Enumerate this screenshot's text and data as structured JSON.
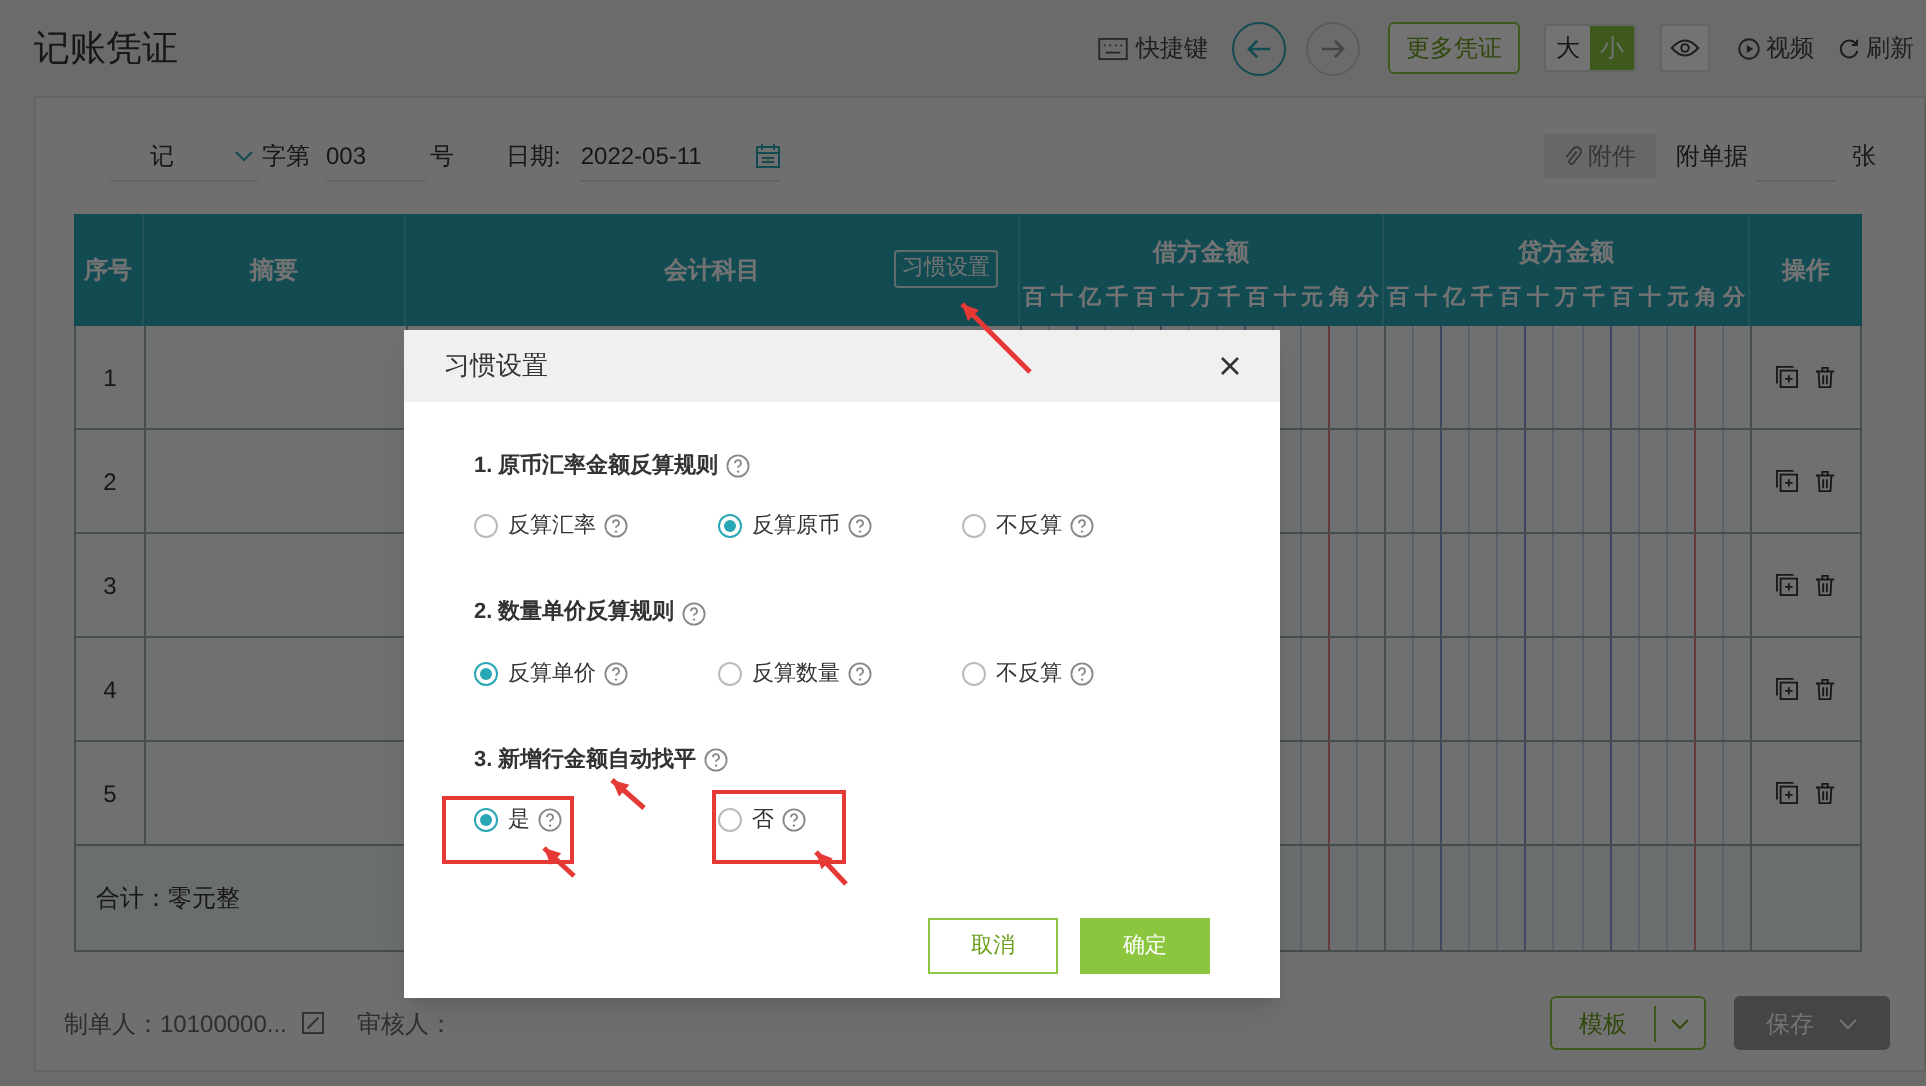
{
  "page": {
    "title": "记账凭证"
  },
  "toolbar": {
    "shortcut": "快捷键",
    "more_vouchers": "更多凭证",
    "size_toggle": [
      {
        "label": "大",
        "selected": false
      },
      {
        "label": "小",
        "selected": true
      }
    ],
    "video": "视频",
    "refresh": "刷新"
  },
  "voucher_header": {
    "type": "记",
    "word_label": "字第",
    "number": "003",
    "number_suffix": "号",
    "date_label": "日期:",
    "date": "2022-05-11",
    "attachment": "附件",
    "attached_docs_label": "附单据",
    "docs_unit": "张"
  },
  "table": {
    "columns": [
      "序号",
      "摘要",
      "会计科目"
    ],
    "habit_button": "习惯设置",
    "debit": "借方金额",
    "credit": "贷方金额",
    "debit_digits": [
      "百",
      "十",
      "亿",
      "千",
      "百",
      "十",
      "万",
      "千",
      "百",
      "十",
      "元",
      "角",
      "分"
    ],
    "credit_digits": [
      "百",
      "十",
      "亿",
      "千",
      "百",
      "十",
      "万",
      "千",
      "百",
      "十",
      "元",
      "角",
      "分"
    ],
    "action": "操作",
    "rows": [
      "1",
      "2",
      "3",
      "4",
      "5"
    ],
    "total": "合计：零元整"
  },
  "footer": {
    "maker_label": "制单人：",
    "maker": "10100000...",
    "reviewer_label": "审核人：",
    "template": "模板",
    "save": "保存",
    "save_disabled": true
  },
  "dialog": {
    "title": "习惯设置",
    "sections": [
      {
        "title": "1. 原币汇率金额反算规则",
        "options": [
          {
            "label": "反算汇率",
            "selected": false
          },
          {
            "label": "反算原币",
            "selected": true
          },
          {
            "label": "不反算",
            "selected": false
          }
        ]
      },
      {
        "title": "2. 数量单价反算规则",
        "options": [
          {
            "label": "反算单价",
            "selected": true
          },
          {
            "label": "反算数量",
            "selected": false
          },
          {
            "label": "不反算",
            "selected": false
          }
        ]
      },
      {
        "title": "3. 新增行金额自动找平",
        "options": [
          {
            "label": "是",
            "selected": true
          },
          {
            "label": "否",
            "selected": false
          }
        ]
      }
    ],
    "cancel": "取消",
    "ok": "确定"
  }
}
